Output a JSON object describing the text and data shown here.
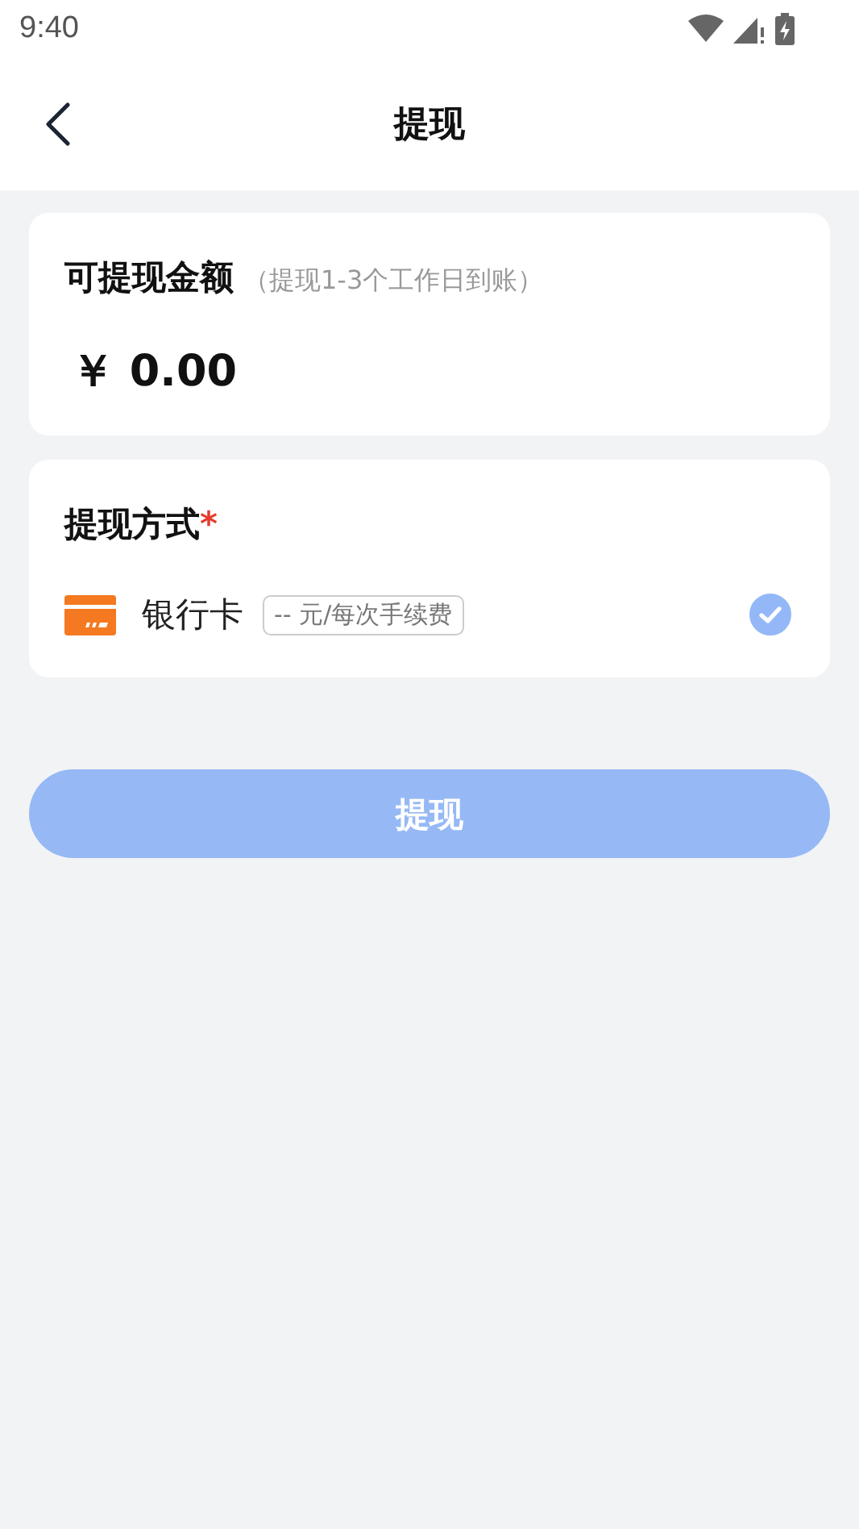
{
  "status_bar": {
    "time": "9:40"
  },
  "header": {
    "title": "提现"
  },
  "balance": {
    "label": "可提现金额",
    "note": "（提现1-3个工作日到账）",
    "amount": "￥ 0.00"
  },
  "method": {
    "label": "提现方式",
    "required_mark": "*",
    "options": [
      {
        "name": "银行卡",
        "fee": "-- 元/每次手续费",
        "selected": true
      }
    ]
  },
  "submit": {
    "label": "提现",
    "disabled": true
  }
}
